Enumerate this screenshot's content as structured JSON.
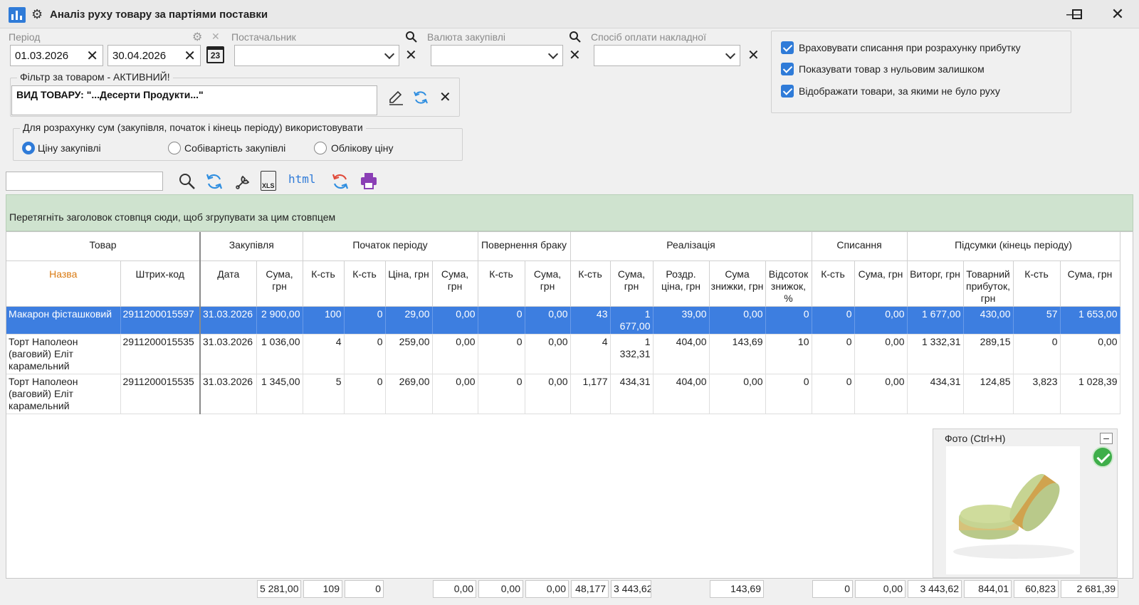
{
  "window": {
    "title": "Аналіз руху товару за партіями поставки",
    "controls": [
      "—",
      "☐",
      "✕"
    ]
  },
  "filters": {
    "period_label": "Період",
    "date_from": "01.03.2026",
    "date_to": "30.04.2026",
    "calendar_icon_text": "23",
    "supplier_label": "Постачальник",
    "supplier_value": "",
    "currency_label": "Валюта закупівлі",
    "currency_value": "",
    "payment_label": "Спосіб оплати накладної",
    "payment_value": ""
  },
  "options": {
    "checkboxes": [
      {
        "label": "Враховувати списання при розрахунку прибутку",
        "checked": true
      },
      {
        "label": "Показувати товар з нульовим залишком",
        "checked": true
      },
      {
        "label": "Відображати товари, за якими не було руху",
        "checked": true
      }
    ]
  },
  "product_filter": {
    "label": "Фільтр за товаром - АКТИВНИЙ!",
    "value": "ВИД ТОВАРУ: \"...Десерти Продукти...\""
  },
  "price_basis": {
    "label": "Для розрахунку сум (закупівля, початок і кінець періоду) використовувати",
    "options": [
      {
        "label": "Ціну закупівлі",
        "selected": true
      },
      {
        "label": "Собівартість закупівлі",
        "selected": false
      },
      {
        "label": "Облікову ціну",
        "selected": false
      }
    ]
  },
  "toolbar": {
    "search_value": "",
    "xls_label": "XLS",
    "html_label": "html"
  },
  "group_hint": "Перетягніть заголовок стовпця сюди, щоб згрупувати за цим стовпцем",
  "grid": {
    "bands": [
      "Товар",
      "Закупівля",
      "Початок періоду",
      "Повернення браку",
      "Реалізація",
      "Списання",
      "Підсумки (кінець періоду)"
    ],
    "columns": [
      "Назва",
      "Штрих-код",
      "Дата",
      "Сума, грн",
      "К-сть",
      "К-сть",
      "Ціна, грн",
      "Сума, грн",
      "К-сть",
      "Сума, грн",
      "К-сть",
      "Сума, грн",
      "Роздр. ціна, грн",
      "Сума знижки, грн",
      "Відсоток знижок, %",
      "К-сть",
      "Сума, грн",
      "Виторг, грн",
      "Товарний прибуток, грн",
      "К-сть",
      "Сума, грн"
    ],
    "rows": [
      [
        "Макарон фісташковий",
        "2911200015597",
        "31.03.2026",
        "2 900,00",
        "100",
        "0",
        "29,00",
        "0,00",
        "0",
        "0,00",
        "43",
        "1 677,00",
        "39,00",
        "0,00",
        "0",
        "0",
        "0,00",
        "1 677,00",
        "430,00",
        "57",
        "1 653,00"
      ],
      [
        "Торт Наполеон (ваговий) Еліт карамельний",
        "2911200015535",
        "31.03.2026",
        "1 036,00",
        "4",
        "0",
        "259,00",
        "0,00",
        "0",
        "0,00",
        "4",
        "1 332,31",
        "404,00",
        "143,69",
        "10",
        "0",
        "0,00",
        "1 332,31",
        "289,15",
        "0",
        "0,00"
      ],
      [
        "Торт Наполеон (ваговий) Еліт карамельний",
        "2911200015535",
        "31.03.2026",
        "1 345,00",
        "5",
        "0",
        "269,00",
        "0,00",
        "0",
        "0,00",
        "1,177",
        "434,31",
        "404,00",
        "0,00",
        "0",
        "0",
        "0,00",
        "434,31",
        "124,85",
        "3,823",
        "1 028,39"
      ]
    ],
    "totals": [
      "5 281,00",
      "109",
      "0",
      "0,00",
      "0,00",
      "0,00",
      "48,177",
      "3 443,62",
      "143,69",
      "0",
      "0,00",
      "3 443,62",
      "844,01",
      "60,823",
      "2 681,39"
    ]
  },
  "photo_panel": {
    "title": "Фото (Ctrl+H)",
    "min_label": "–"
  },
  "colors": {
    "accent": "#2f7bd8",
    "selected_row": "#3d7ee0",
    "group_hint_bg": "#cfe3cf",
    "header_orange": "#d97a12",
    "refresh_blue": "#2f8ee0",
    "refresh_red": "#e04a3a",
    "print_purple": "#8a3fb5"
  }
}
